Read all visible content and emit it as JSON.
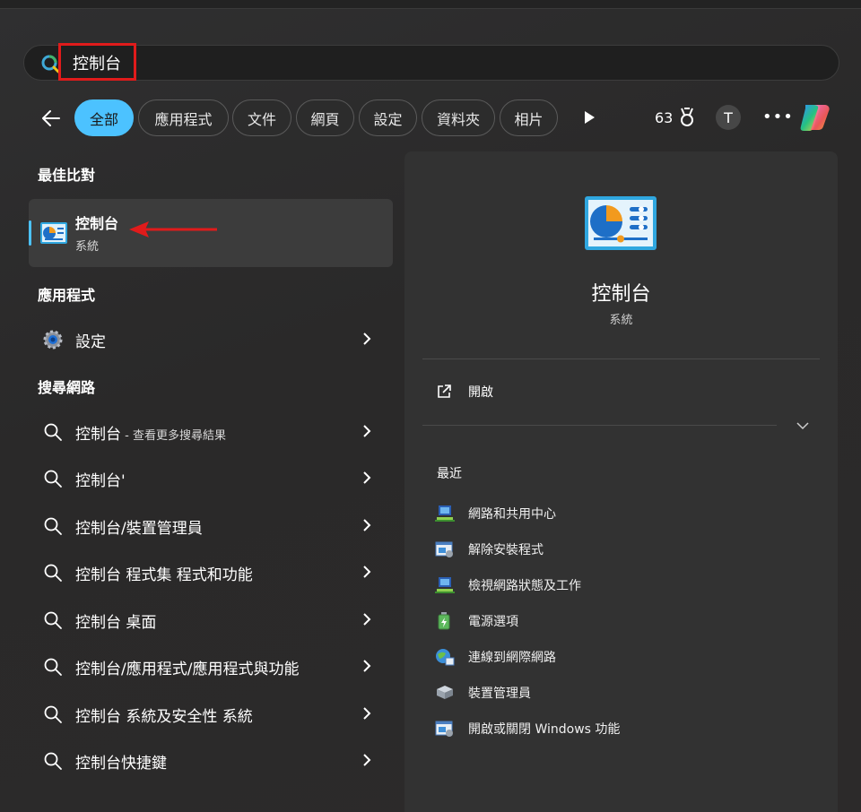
{
  "search": {
    "query": "控制台"
  },
  "filters": {
    "tabs": [
      {
        "label": "全部",
        "active": true
      },
      {
        "label": "應用程式"
      },
      {
        "label": "文件"
      },
      {
        "label": "網頁"
      },
      {
        "label": "設定"
      },
      {
        "label": "資料夾"
      },
      {
        "label": "相片"
      }
    ],
    "points": "63",
    "avatar_initial": "T"
  },
  "best_match": {
    "heading": "最佳比對",
    "title": "控制台",
    "subtitle": "系統"
  },
  "apps": {
    "heading": "應用程式",
    "items": [
      {
        "label": "設定",
        "icon": "gear-icon"
      }
    ]
  },
  "web": {
    "heading": "搜尋網路",
    "items": [
      {
        "label": "控制台",
        "suffix": " - 查看更多搜尋結果"
      },
      {
        "label": "控制台'",
        "suffix": ""
      },
      {
        "label": "控制台/裝置管理員",
        "suffix": ""
      },
      {
        "label": "控制台 程式集 程式和功能",
        "suffix": ""
      },
      {
        "label": "控制台 桌面",
        "suffix": ""
      },
      {
        "label": "控制台/應用程式/應用程式與功能",
        "suffix": ""
      },
      {
        "label": "控制台 系統及安全性 系統",
        "suffix": ""
      },
      {
        "label": "控制台快捷鍵",
        "suffix": ""
      }
    ]
  },
  "detail": {
    "title": "控制台",
    "subtitle": "系統",
    "open_label": "開啟",
    "recent_heading": "最近",
    "recent": [
      {
        "label": "網路和共用中心",
        "icon": "network-icon"
      },
      {
        "label": "解除安裝程式",
        "icon": "programs-icon"
      },
      {
        "label": "檢視網路狀態及工作",
        "icon": "network-icon"
      },
      {
        "label": "電源選項",
        "icon": "battery-icon"
      },
      {
        "label": "連線到網際網路",
        "icon": "globe-icon"
      },
      {
        "label": "裝置管理員",
        "icon": "device-manager-icon"
      },
      {
        "label": "開啟或關閉 Windows 功能",
        "icon": "programs-icon"
      }
    ]
  },
  "colors": {
    "accent": "#4cc2ff",
    "highlight_box": "#e01b1b"
  }
}
